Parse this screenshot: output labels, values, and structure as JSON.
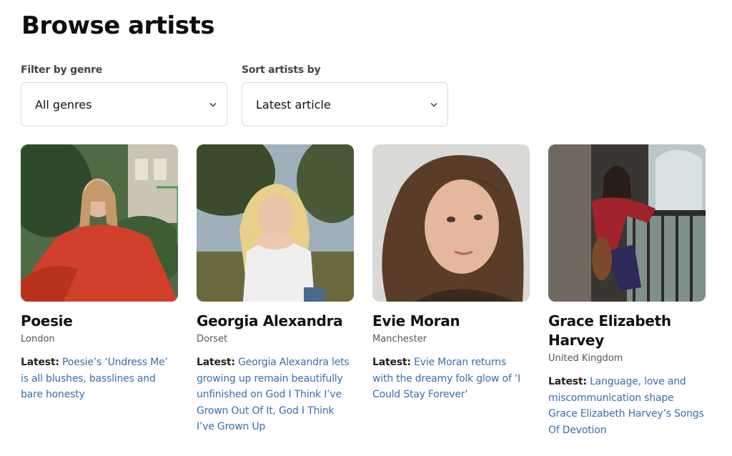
{
  "page": {
    "title": "Browse artists"
  },
  "filters": {
    "genre": {
      "label": "Filter by genre",
      "value": "All genres",
      "icon": "chevron-down-icon"
    },
    "sort": {
      "label": "Sort artists by",
      "value": "Latest article",
      "icon": "chevron-down-icon"
    }
  },
  "latest_label": "Latest:",
  "colors": {
    "link": "#3b6ea8",
    "title": "#0d0d0d",
    "muted": "#555555"
  },
  "artists": [
    {
      "name": "Poesie",
      "location": "London",
      "latest": "Poesie’s ‘Undress Me’ is all blushes, basslines and bare honesty"
    },
    {
      "name": "Georgia Alexandra",
      "location": "Dorset",
      "latest": "Georgia Alexandra lets growing up remain beautifully unfinished on God I Think I’ve Grown Out Of It, God I Think I’ve Grown Up"
    },
    {
      "name": "Evie Moran",
      "location": "Manchester",
      "latest": "Evie Moran returns with the dreamy folk glow of ‘I Could Stay Forever’"
    },
    {
      "name": "Grace Elizabeth Harvey",
      "location": "United Kingdom",
      "latest": "Language, love and miscommunication shape Grace Elizabeth Harvey’s Songs Of Devotion"
    }
  ]
}
